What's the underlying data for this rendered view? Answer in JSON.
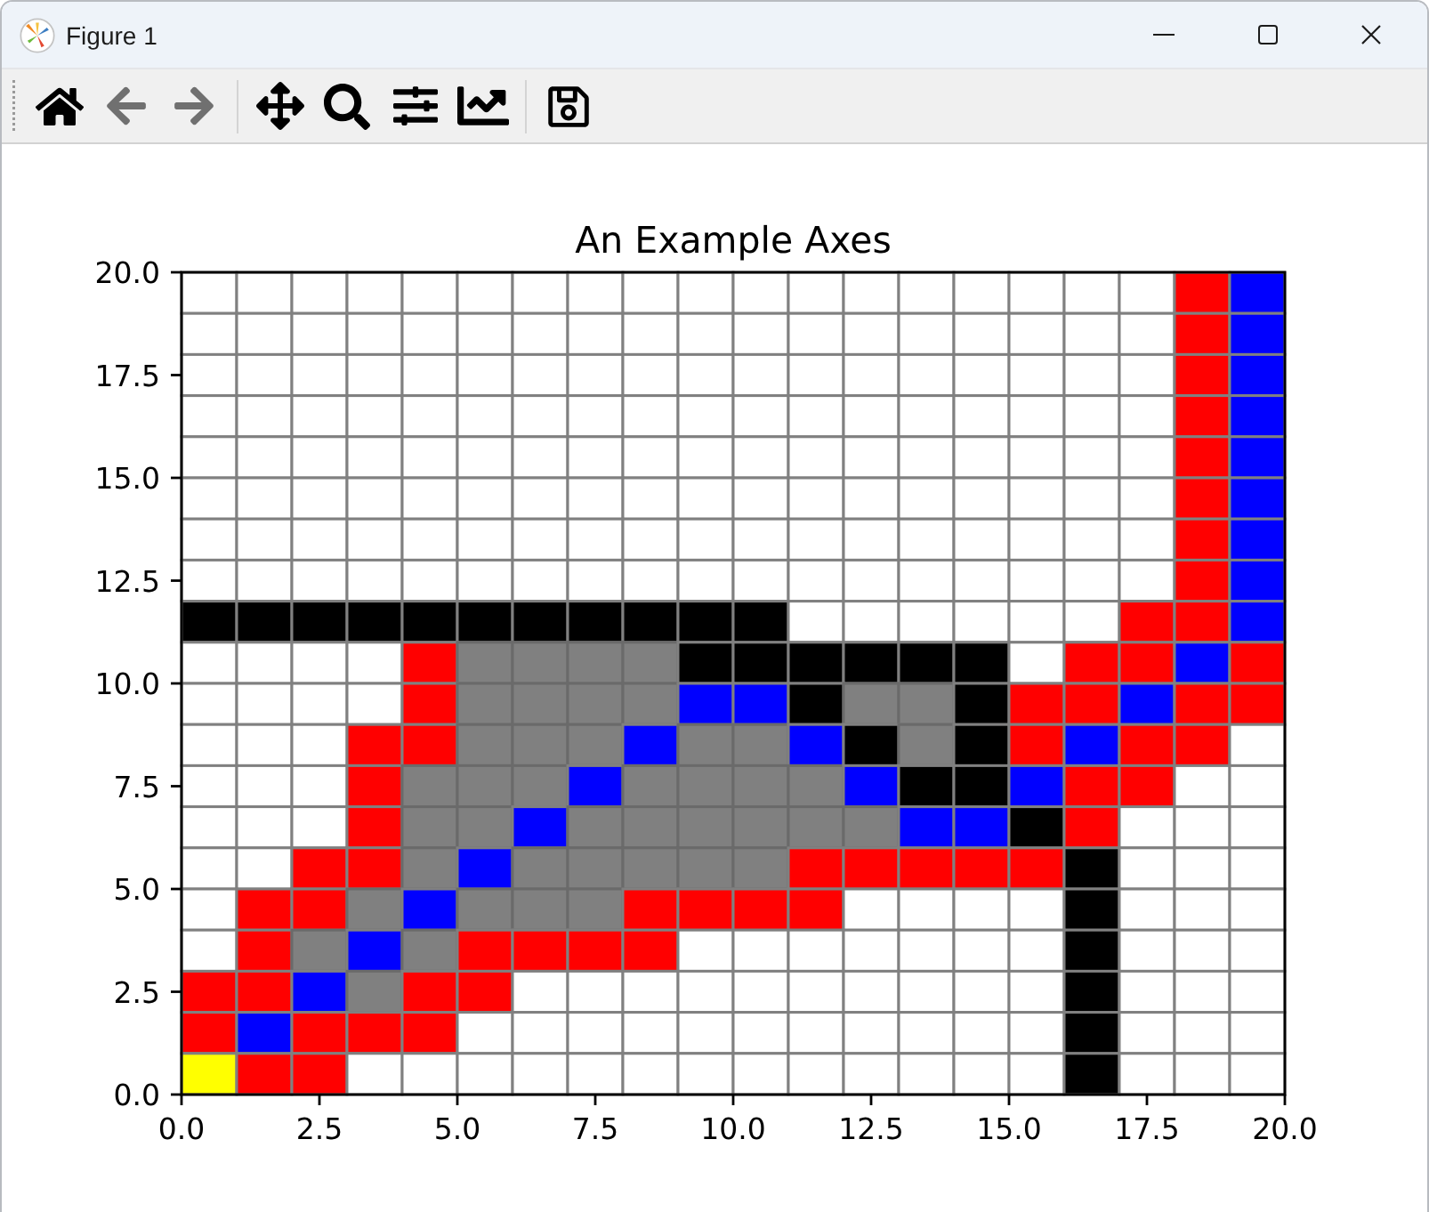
{
  "window": {
    "title": "Figure 1"
  },
  "toolbar": {
    "groups": [
      {
        "buttons": [
          {
            "kind": "home",
            "disabled": false
          },
          {
            "kind": "back",
            "disabled": true
          },
          {
            "kind": "forward",
            "disabled": true
          }
        ]
      },
      {
        "buttons": [
          {
            "kind": "pan",
            "disabled": false
          },
          {
            "kind": "zoom",
            "disabled": false
          },
          {
            "kind": "subplots",
            "disabled": false
          },
          {
            "kind": "customize",
            "disabled": false
          }
        ]
      },
      {
        "buttons": [
          {
            "kind": "save",
            "disabled": false
          }
        ]
      }
    ]
  },
  "axes": {
    "title": "An Example Axes",
    "xticks": [
      "0.0",
      "2.5",
      "5.0",
      "7.5",
      "10.0",
      "12.5",
      "15.0",
      "17.5",
      "20.0"
    ],
    "yticks": [
      "20.0",
      "17.5",
      "15.0",
      "12.5",
      "10.0",
      "7.5",
      "5.0",
      "2.5",
      "0.0"
    ],
    "rows": [
      {
        "cells": [
          {
            "color": "#ffffff"
          },
          {
            "color": "#ffffff"
          },
          {
            "color": "#ffffff"
          },
          {
            "color": "#ffffff"
          },
          {
            "color": "#ffffff"
          },
          {
            "color": "#ffffff"
          },
          {
            "color": "#ffffff"
          },
          {
            "color": "#ffffff"
          },
          {
            "color": "#ffffff"
          },
          {
            "color": "#ffffff"
          },
          {
            "color": "#ffffff"
          },
          {
            "color": "#ffffff"
          },
          {
            "color": "#ffffff"
          },
          {
            "color": "#ffffff"
          },
          {
            "color": "#ffffff"
          },
          {
            "color": "#ffffff"
          },
          {
            "color": "#ffffff"
          },
          {
            "color": "#ffffff"
          },
          {
            "color": "#ff0000"
          },
          {
            "color": "#0000ff"
          }
        ]
      },
      {
        "cells": [
          {
            "color": "#ffffff"
          },
          {
            "color": "#ffffff"
          },
          {
            "color": "#ffffff"
          },
          {
            "color": "#ffffff"
          },
          {
            "color": "#ffffff"
          },
          {
            "color": "#ffffff"
          },
          {
            "color": "#ffffff"
          },
          {
            "color": "#ffffff"
          },
          {
            "color": "#ffffff"
          },
          {
            "color": "#ffffff"
          },
          {
            "color": "#ffffff"
          },
          {
            "color": "#ffffff"
          },
          {
            "color": "#ffffff"
          },
          {
            "color": "#ffffff"
          },
          {
            "color": "#ffffff"
          },
          {
            "color": "#ffffff"
          },
          {
            "color": "#ffffff"
          },
          {
            "color": "#ffffff"
          },
          {
            "color": "#ff0000"
          },
          {
            "color": "#0000ff"
          }
        ]
      },
      {
        "cells": [
          {
            "color": "#ffffff"
          },
          {
            "color": "#ffffff"
          },
          {
            "color": "#ffffff"
          },
          {
            "color": "#ffffff"
          },
          {
            "color": "#ffffff"
          },
          {
            "color": "#ffffff"
          },
          {
            "color": "#ffffff"
          },
          {
            "color": "#ffffff"
          },
          {
            "color": "#ffffff"
          },
          {
            "color": "#ffffff"
          },
          {
            "color": "#ffffff"
          },
          {
            "color": "#ffffff"
          },
          {
            "color": "#ffffff"
          },
          {
            "color": "#ffffff"
          },
          {
            "color": "#ffffff"
          },
          {
            "color": "#ffffff"
          },
          {
            "color": "#ffffff"
          },
          {
            "color": "#ffffff"
          },
          {
            "color": "#ff0000"
          },
          {
            "color": "#0000ff"
          }
        ]
      },
      {
        "cells": [
          {
            "color": "#ffffff"
          },
          {
            "color": "#ffffff"
          },
          {
            "color": "#ffffff"
          },
          {
            "color": "#ffffff"
          },
          {
            "color": "#ffffff"
          },
          {
            "color": "#ffffff"
          },
          {
            "color": "#ffffff"
          },
          {
            "color": "#ffffff"
          },
          {
            "color": "#ffffff"
          },
          {
            "color": "#ffffff"
          },
          {
            "color": "#ffffff"
          },
          {
            "color": "#ffffff"
          },
          {
            "color": "#ffffff"
          },
          {
            "color": "#ffffff"
          },
          {
            "color": "#ffffff"
          },
          {
            "color": "#ffffff"
          },
          {
            "color": "#ffffff"
          },
          {
            "color": "#ffffff"
          },
          {
            "color": "#ff0000"
          },
          {
            "color": "#0000ff"
          }
        ]
      },
      {
        "cells": [
          {
            "color": "#ffffff"
          },
          {
            "color": "#ffffff"
          },
          {
            "color": "#ffffff"
          },
          {
            "color": "#ffffff"
          },
          {
            "color": "#ffffff"
          },
          {
            "color": "#ffffff"
          },
          {
            "color": "#ffffff"
          },
          {
            "color": "#ffffff"
          },
          {
            "color": "#ffffff"
          },
          {
            "color": "#ffffff"
          },
          {
            "color": "#ffffff"
          },
          {
            "color": "#ffffff"
          },
          {
            "color": "#ffffff"
          },
          {
            "color": "#ffffff"
          },
          {
            "color": "#ffffff"
          },
          {
            "color": "#ffffff"
          },
          {
            "color": "#ffffff"
          },
          {
            "color": "#ffffff"
          },
          {
            "color": "#ff0000"
          },
          {
            "color": "#0000ff"
          }
        ]
      },
      {
        "cells": [
          {
            "color": "#ffffff"
          },
          {
            "color": "#ffffff"
          },
          {
            "color": "#ffffff"
          },
          {
            "color": "#ffffff"
          },
          {
            "color": "#ffffff"
          },
          {
            "color": "#ffffff"
          },
          {
            "color": "#ffffff"
          },
          {
            "color": "#ffffff"
          },
          {
            "color": "#ffffff"
          },
          {
            "color": "#ffffff"
          },
          {
            "color": "#ffffff"
          },
          {
            "color": "#ffffff"
          },
          {
            "color": "#ffffff"
          },
          {
            "color": "#ffffff"
          },
          {
            "color": "#ffffff"
          },
          {
            "color": "#ffffff"
          },
          {
            "color": "#ffffff"
          },
          {
            "color": "#ffffff"
          },
          {
            "color": "#ff0000"
          },
          {
            "color": "#0000ff"
          }
        ]
      },
      {
        "cells": [
          {
            "color": "#ffffff"
          },
          {
            "color": "#ffffff"
          },
          {
            "color": "#ffffff"
          },
          {
            "color": "#ffffff"
          },
          {
            "color": "#ffffff"
          },
          {
            "color": "#ffffff"
          },
          {
            "color": "#ffffff"
          },
          {
            "color": "#ffffff"
          },
          {
            "color": "#ffffff"
          },
          {
            "color": "#ffffff"
          },
          {
            "color": "#ffffff"
          },
          {
            "color": "#ffffff"
          },
          {
            "color": "#ffffff"
          },
          {
            "color": "#ffffff"
          },
          {
            "color": "#ffffff"
          },
          {
            "color": "#ffffff"
          },
          {
            "color": "#ffffff"
          },
          {
            "color": "#ffffff"
          },
          {
            "color": "#ff0000"
          },
          {
            "color": "#0000ff"
          }
        ]
      },
      {
        "cells": [
          {
            "color": "#ffffff"
          },
          {
            "color": "#ffffff"
          },
          {
            "color": "#ffffff"
          },
          {
            "color": "#ffffff"
          },
          {
            "color": "#ffffff"
          },
          {
            "color": "#ffffff"
          },
          {
            "color": "#ffffff"
          },
          {
            "color": "#ffffff"
          },
          {
            "color": "#ffffff"
          },
          {
            "color": "#ffffff"
          },
          {
            "color": "#ffffff"
          },
          {
            "color": "#ffffff"
          },
          {
            "color": "#ffffff"
          },
          {
            "color": "#ffffff"
          },
          {
            "color": "#ffffff"
          },
          {
            "color": "#ffffff"
          },
          {
            "color": "#ffffff"
          },
          {
            "color": "#ffffff"
          },
          {
            "color": "#ff0000"
          },
          {
            "color": "#0000ff"
          }
        ]
      },
      {
        "cells": [
          {
            "color": "#000000"
          },
          {
            "color": "#000000"
          },
          {
            "color": "#000000"
          },
          {
            "color": "#000000"
          },
          {
            "color": "#000000"
          },
          {
            "color": "#000000"
          },
          {
            "color": "#000000"
          },
          {
            "color": "#000000"
          },
          {
            "color": "#000000"
          },
          {
            "color": "#000000"
          },
          {
            "color": "#000000"
          },
          {
            "color": "#ffffff"
          },
          {
            "color": "#ffffff"
          },
          {
            "color": "#ffffff"
          },
          {
            "color": "#ffffff"
          },
          {
            "color": "#ffffff"
          },
          {
            "color": "#ffffff"
          },
          {
            "color": "#ff0000"
          },
          {
            "color": "#ff0000"
          },
          {
            "color": "#0000ff"
          }
        ]
      },
      {
        "cells": [
          {
            "color": "#ffffff"
          },
          {
            "color": "#ffffff"
          },
          {
            "color": "#ffffff"
          },
          {
            "color": "#ffffff"
          },
          {
            "color": "#ff0000"
          },
          {
            "color": "#808080"
          },
          {
            "color": "#808080"
          },
          {
            "color": "#808080"
          },
          {
            "color": "#808080"
          },
          {
            "color": "#000000"
          },
          {
            "color": "#000000"
          },
          {
            "color": "#000000"
          },
          {
            "color": "#000000"
          },
          {
            "color": "#000000"
          },
          {
            "color": "#000000"
          },
          {
            "color": "#ffffff"
          },
          {
            "color": "#ff0000"
          },
          {
            "color": "#ff0000"
          },
          {
            "color": "#0000ff"
          },
          {
            "color": "#ff0000"
          }
        ]
      },
      {
        "cells": [
          {
            "color": "#ffffff"
          },
          {
            "color": "#ffffff"
          },
          {
            "color": "#ffffff"
          },
          {
            "color": "#ffffff"
          },
          {
            "color": "#ff0000"
          },
          {
            "color": "#808080"
          },
          {
            "color": "#808080"
          },
          {
            "color": "#808080"
          },
          {
            "color": "#808080"
          },
          {
            "color": "#0000ff"
          },
          {
            "color": "#0000ff"
          },
          {
            "color": "#000000"
          },
          {
            "color": "#808080"
          },
          {
            "color": "#808080"
          },
          {
            "color": "#000000"
          },
          {
            "color": "#ff0000"
          },
          {
            "color": "#ff0000"
          },
          {
            "color": "#0000ff"
          },
          {
            "color": "#ff0000"
          },
          {
            "color": "#ff0000"
          }
        ]
      },
      {
        "cells": [
          {
            "color": "#ffffff"
          },
          {
            "color": "#ffffff"
          },
          {
            "color": "#ffffff"
          },
          {
            "color": "#ff0000"
          },
          {
            "color": "#ff0000"
          },
          {
            "color": "#808080"
          },
          {
            "color": "#808080"
          },
          {
            "color": "#808080"
          },
          {
            "color": "#0000ff"
          },
          {
            "color": "#808080"
          },
          {
            "color": "#808080"
          },
          {
            "color": "#0000ff"
          },
          {
            "color": "#000000"
          },
          {
            "color": "#808080"
          },
          {
            "color": "#000000"
          },
          {
            "color": "#ff0000"
          },
          {
            "color": "#0000ff"
          },
          {
            "color": "#ff0000"
          },
          {
            "color": "#ff0000"
          },
          {
            "color": "#ffffff"
          }
        ]
      },
      {
        "cells": [
          {
            "color": "#ffffff"
          },
          {
            "color": "#ffffff"
          },
          {
            "color": "#ffffff"
          },
          {
            "color": "#ff0000"
          },
          {
            "color": "#808080"
          },
          {
            "color": "#808080"
          },
          {
            "color": "#808080"
          },
          {
            "color": "#0000ff"
          },
          {
            "color": "#808080"
          },
          {
            "color": "#808080"
          },
          {
            "color": "#808080"
          },
          {
            "color": "#808080"
          },
          {
            "color": "#0000ff"
          },
          {
            "color": "#000000"
          },
          {
            "color": "#000000"
          },
          {
            "color": "#0000ff"
          },
          {
            "color": "#ff0000"
          },
          {
            "color": "#ff0000"
          },
          {
            "color": "#ffffff"
          },
          {
            "color": "#ffffff"
          }
        ]
      },
      {
        "cells": [
          {
            "color": "#ffffff"
          },
          {
            "color": "#ffffff"
          },
          {
            "color": "#ffffff"
          },
          {
            "color": "#ff0000"
          },
          {
            "color": "#808080"
          },
          {
            "color": "#808080"
          },
          {
            "color": "#0000ff"
          },
          {
            "color": "#808080"
          },
          {
            "color": "#808080"
          },
          {
            "color": "#808080"
          },
          {
            "color": "#808080"
          },
          {
            "color": "#808080"
          },
          {
            "color": "#808080"
          },
          {
            "color": "#0000ff"
          },
          {
            "color": "#0000ff"
          },
          {
            "color": "#000000"
          },
          {
            "color": "#ff0000"
          },
          {
            "color": "#ffffff"
          },
          {
            "color": "#ffffff"
          },
          {
            "color": "#ffffff"
          }
        ]
      },
      {
        "cells": [
          {
            "color": "#ffffff"
          },
          {
            "color": "#ffffff"
          },
          {
            "color": "#ff0000"
          },
          {
            "color": "#ff0000"
          },
          {
            "color": "#808080"
          },
          {
            "color": "#0000ff"
          },
          {
            "color": "#808080"
          },
          {
            "color": "#808080"
          },
          {
            "color": "#808080"
          },
          {
            "color": "#808080"
          },
          {
            "color": "#808080"
          },
          {
            "color": "#ff0000"
          },
          {
            "color": "#ff0000"
          },
          {
            "color": "#ff0000"
          },
          {
            "color": "#ff0000"
          },
          {
            "color": "#ff0000"
          },
          {
            "color": "#000000"
          },
          {
            "color": "#ffffff"
          },
          {
            "color": "#ffffff"
          },
          {
            "color": "#ffffff"
          }
        ]
      },
      {
        "cells": [
          {
            "color": "#ffffff"
          },
          {
            "color": "#ff0000"
          },
          {
            "color": "#ff0000"
          },
          {
            "color": "#808080"
          },
          {
            "color": "#0000ff"
          },
          {
            "color": "#808080"
          },
          {
            "color": "#808080"
          },
          {
            "color": "#808080"
          },
          {
            "color": "#ff0000"
          },
          {
            "color": "#ff0000"
          },
          {
            "color": "#ff0000"
          },
          {
            "color": "#ff0000"
          },
          {
            "color": "#ffffff"
          },
          {
            "color": "#ffffff"
          },
          {
            "color": "#ffffff"
          },
          {
            "color": "#ffffff"
          },
          {
            "color": "#000000"
          },
          {
            "color": "#ffffff"
          },
          {
            "color": "#ffffff"
          },
          {
            "color": "#ffffff"
          }
        ]
      },
      {
        "cells": [
          {
            "color": "#ffffff"
          },
          {
            "color": "#ff0000"
          },
          {
            "color": "#808080"
          },
          {
            "color": "#0000ff"
          },
          {
            "color": "#808080"
          },
          {
            "color": "#ff0000"
          },
          {
            "color": "#ff0000"
          },
          {
            "color": "#ff0000"
          },
          {
            "color": "#ff0000"
          },
          {
            "color": "#ffffff"
          },
          {
            "color": "#ffffff"
          },
          {
            "color": "#ffffff"
          },
          {
            "color": "#ffffff"
          },
          {
            "color": "#ffffff"
          },
          {
            "color": "#ffffff"
          },
          {
            "color": "#ffffff"
          },
          {
            "color": "#000000"
          },
          {
            "color": "#ffffff"
          },
          {
            "color": "#ffffff"
          },
          {
            "color": "#ffffff"
          }
        ]
      },
      {
        "cells": [
          {
            "color": "#ff0000"
          },
          {
            "color": "#ff0000"
          },
          {
            "color": "#0000ff"
          },
          {
            "color": "#808080"
          },
          {
            "color": "#ff0000"
          },
          {
            "color": "#ff0000"
          },
          {
            "color": "#ffffff"
          },
          {
            "color": "#ffffff"
          },
          {
            "color": "#ffffff"
          },
          {
            "color": "#ffffff"
          },
          {
            "color": "#ffffff"
          },
          {
            "color": "#ffffff"
          },
          {
            "color": "#ffffff"
          },
          {
            "color": "#ffffff"
          },
          {
            "color": "#ffffff"
          },
          {
            "color": "#ffffff"
          },
          {
            "color": "#000000"
          },
          {
            "color": "#ffffff"
          },
          {
            "color": "#ffffff"
          },
          {
            "color": "#ffffff"
          }
        ]
      },
      {
        "cells": [
          {
            "color": "#ff0000"
          },
          {
            "color": "#0000ff"
          },
          {
            "color": "#ff0000"
          },
          {
            "color": "#ff0000"
          },
          {
            "color": "#ff0000"
          },
          {
            "color": "#ffffff"
          },
          {
            "color": "#ffffff"
          },
          {
            "color": "#ffffff"
          },
          {
            "color": "#ffffff"
          },
          {
            "color": "#ffffff"
          },
          {
            "color": "#ffffff"
          },
          {
            "color": "#ffffff"
          },
          {
            "color": "#ffffff"
          },
          {
            "color": "#ffffff"
          },
          {
            "color": "#ffffff"
          },
          {
            "color": "#ffffff"
          },
          {
            "color": "#000000"
          },
          {
            "color": "#ffffff"
          },
          {
            "color": "#ffffff"
          },
          {
            "color": "#ffffff"
          }
        ]
      },
      {
        "cells": [
          {
            "color": "#ffff00"
          },
          {
            "color": "#ff0000"
          },
          {
            "color": "#ff0000"
          },
          {
            "color": "#ffffff"
          },
          {
            "color": "#ffffff"
          },
          {
            "color": "#ffffff"
          },
          {
            "color": "#ffffff"
          },
          {
            "color": "#ffffff"
          },
          {
            "color": "#ffffff"
          },
          {
            "color": "#ffffff"
          },
          {
            "color": "#ffffff"
          },
          {
            "color": "#ffffff"
          },
          {
            "color": "#ffffff"
          },
          {
            "color": "#ffffff"
          },
          {
            "color": "#ffffff"
          },
          {
            "color": "#ffffff"
          },
          {
            "color": "#000000"
          },
          {
            "color": "#ffffff"
          },
          {
            "color": "#ffffff"
          },
          {
            "color": "#ffffff"
          }
        ]
      }
    ]
  }
}
